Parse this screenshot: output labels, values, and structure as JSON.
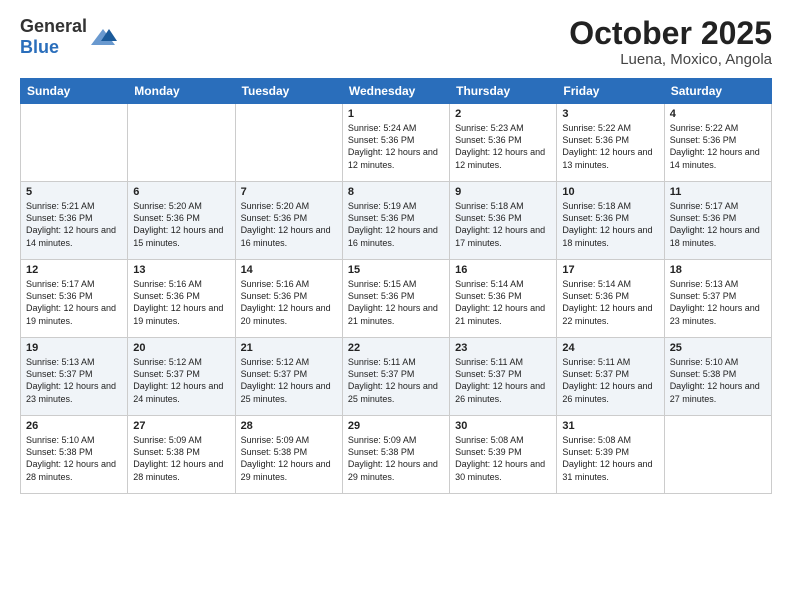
{
  "logo": {
    "general": "General",
    "blue": "Blue"
  },
  "header": {
    "title": "October 2025",
    "subtitle": "Luena, Moxico, Angola"
  },
  "days_of_week": [
    "Sunday",
    "Monday",
    "Tuesday",
    "Wednesday",
    "Thursday",
    "Friday",
    "Saturday"
  ],
  "weeks": [
    [
      {
        "day": "",
        "info": ""
      },
      {
        "day": "",
        "info": ""
      },
      {
        "day": "",
        "info": ""
      },
      {
        "day": "1",
        "info": "Sunrise: 5:24 AM\nSunset: 5:36 PM\nDaylight: 12 hours and 12 minutes."
      },
      {
        "day": "2",
        "info": "Sunrise: 5:23 AM\nSunset: 5:36 PM\nDaylight: 12 hours and 12 minutes."
      },
      {
        "day": "3",
        "info": "Sunrise: 5:22 AM\nSunset: 5:36 PM\nDaylight: 12 hours and 13 minutes."
      },
      {
        "day": "4",
        "info": "Sunrise: 5:22 AM\nSunset: 5:36 PM\nDaylight: 12 hours and 14 minutes."
      }
    ],
    [
      {
        "day": "5",
        "info": "Sunrise: 5:21 AM\nSunset: 5:36 PM\nDaylight: 12 hours and 14 minutes."
      },
      {
        "day": "6",
        "info": "Sunrise: 5:20 AM\nSunset: 5:36 PM\nDaylight: 12 hours and 15 minutes."
      },
      {
        "day": "7",
        "info": "Sunrise: 5:20 AM\nSunset: 5:36 PM\nDaylight: 12 hours and 16 minutes."
      },
      {
        "day": "8",
        "info": "Sunrise: 5:19 AM\nSunset: 5:36 PM\nDaylight: 12 hours and 16 minutes."
      },
      {
        "day": "9",
        "info": "Sunrise: 5:18 AM\nSunset: 5:36 PM\nDaylight: 12 hours and 17 minutes."
      },
      {
        "day": "10",
        "info": "Sunrise: 5:18 AM\nSunset: 5:36 PM\nDaylight: 12 hours and 18 minutes."
      },
      {
        "day": "11",
        "info": "Sunrise: 5:17 AM\nSunset: 5:36 PM\nDaylight: 12 hours and 18 minutes."
      }
    ],
    [
      {
        "day": "12",
        "info": "Sunrise: 5:17 AM\nSunset: 5:36 PM\nDaylight: 12 hours and 19 minutes."
      },
      {
        "day": "13",
        "info": "Sunrise: 5:16 AM\nSunset: 5:36 PM\nDaylight: 12 hours and 19 minutes."
      },
      {
        "day": "14",
        "info": "Sunrise: 5:16 AM\nSunset: 5:36 PM\nDaylight: 12 hours and 20 minutes."
      },
      {
        "day": "15",
        "info": "Sunrise: 5:15 AM\nSunset: 5:36 PM\nDaylight: 12 hours and 21 minutes."
      },
      {
        "day": "16",
        "info": "Sunrise: 5:14 AM\nSunset: 5:36 PM\nDaylight: 12 hours and 21 minutes."
      },
      {
        "day": "17",
        "info": "Sunrise: 5:14 AM\nSunset: 5:36 PM\nDaylight: 12 hours and 22 minutes."
      },
      {
        "day": "18",
        "info": "Sunrise: 5:13 AM\nSunset: 5:37 PM\nDaylight: 12 hours and 23 minutes."
      }
    ],
    [
      {
        "day": "19",
        "info": "Sunrise: 5:13 AM\nSunset: 5:37 PM\nDaylight: 12 hours and 23 minutes."
      },
      {
        "day": "20",
        "info": "Sunrise: 5:12 AM\nSunset: 5:37 PM\nDaylight: 12 hours and 24 minutes."
      },
      {
        "day": "21",
        "info": "Sunrise: 5:12 AM\nSunset: 5:37 PM\nDaylight: 12 hours and 25 minutes."
      },
      {
        "day": "22",
        "info": "Sunrise: 5:11 AM\nSunset: 5:37 PM\nDaylight: 12 hours and 25 minutes."
      },
      {
        "day": "23",
        "info": "Sunrise: 5:11 AM\nSunset: 5:37 PM\nDaylight: 12 hours and 26 minutes."
      },
      {
        "day": "24",
        "info": "Sunrise: 5:11 AM\nSunset: 5:37 PM\nDaylight: 12 hours and 26 minutes."
      },
      {
        "day": "25",
        "info": "Sunrise: 5:10 AM\nSunset: 5:38 PM\nDaylight: 12 hours and 27 minutes."
      }
    ],
    [
      {
        "day": "26",
        "info": "Sunrise: 5:10 AM\nSunset: 5:38 PM\nDaylight: 12 hours and 28 minutes."
      },
      {
        "day": "27",
        "info": "Sunrise: 5:09 AM\nSunset: 5:38 PM\nDaylight: 12 hours and 28 minutes."
      },
      {
        "day": "28",
        "info": "Sunrise: 5:09 AM\nSunset: 5:38 PM\nDaylight: 12 hours and 29 minutes."
      },
      {
        "day": "29",
        "info": "Sunrise: 5:09 AM\nSunset: 5:38 PM\nDaylight: 12 hours and 29 minutes."
      },
      {
        "day": "30",
        "info": "Sunrise: 5:08 AM\nSunset: 5:39 PM\nDaylight: 12 hours and 30 minutes."
      },
      {
        "day": "31",
        "info": "Sunrise: 5:08 AM\nSunset: 5:39 PM\nDaylight: 12 hours and 31 minutes."
      },
      {
        "day": "",
        "info": ""
      }
    ]
  ]
}
